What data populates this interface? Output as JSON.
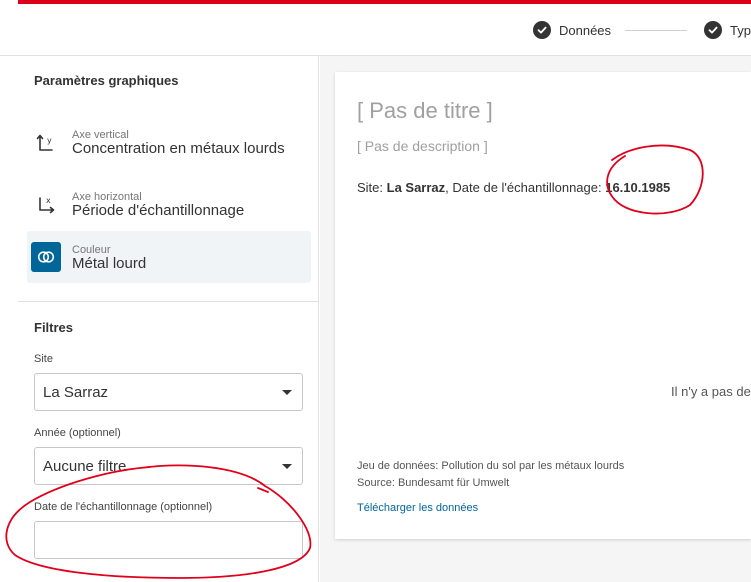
{
  "stepper": {
    "steps": [
      {
        "label": "Données"
      },
      {
        "label": "Typ"
      }
    ]
  },
  "sidebar": {
    "chart_options_title": "Paramètres graphiques",
    "options": [
      {
        "small": "Axe vertical",
        "main": "Concentration en métaux lourds",
        "icon": "y-axis-icon"
      },
      {
        "small": "Axe horizontal",
        "main": "Période d'échantillonnage",
        "icon": "x-axis-icon"
      },
      {
        "small": "Couleur",
        "main": "Métal lourd",
        "icon": "color-segment-icon",
        "active": true
      }
    ],
    "filters_title": "Filtres",
    "filters": {
      "site": {
        "label": "Site",
        "value": "La Sarraz"
      },
      "year": {
        "label": "Année (optionnel)",
        "value": "Aucune filtre"
      },
      "date": {
        "label": "Date de l'échantillonnage (optionnel)",
        "value": "",
        "placeholder": ""
      }
    }
  },
  "chart": {
    "title": "[ Pas de titre ]",
    "description": "[ Pas de description ]",
    "meta": {
      "site_label": "Site: ",
      "site_value": "La Sarraz",
      "date_label": ", Date de l'échantillonnage: ",
      "date_value": "16.10.1985"
    },
    "no_data": "Il n'y a pas de",
    "dataset": "Jeu de données: Pollution du sol par les métaux lourds",
    "source": "Source: Bundesamt für Umwelt",
    "download": "Télécharger les données"
  },
  "colors": {
    "brand_red": "#dc0018",
    "accent_blue": "#006699",
    "annotation_red": "#e0001b"
  }
}
